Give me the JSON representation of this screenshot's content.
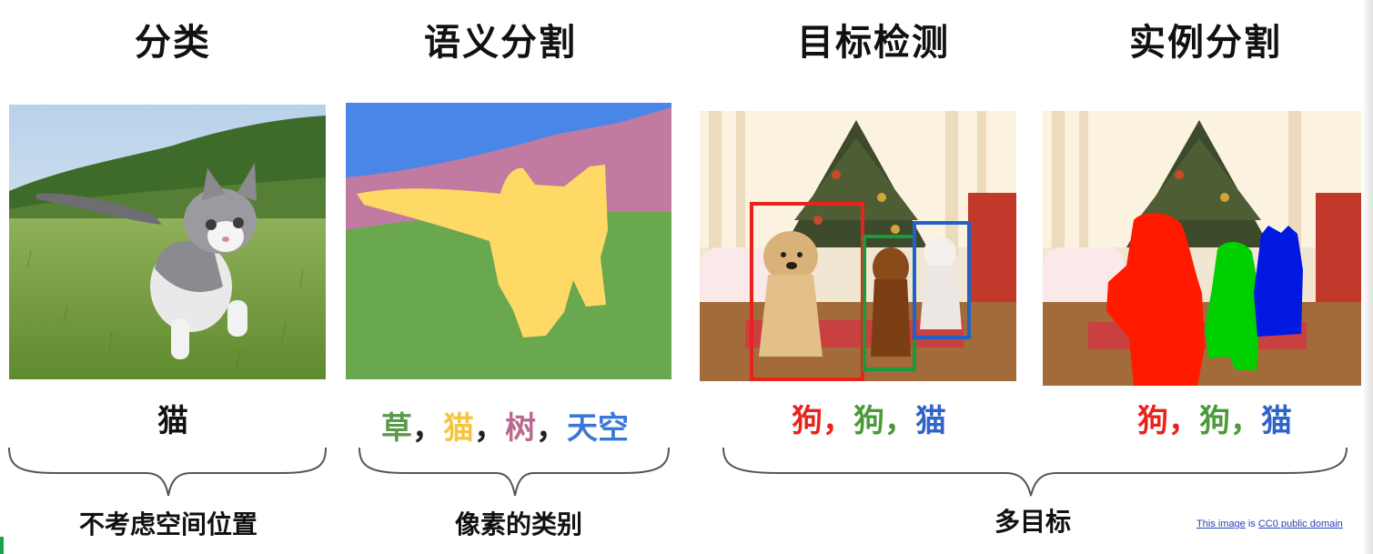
{
  "titles": {
    "classification": "分类",
    "semantic_segmentation": "语义分割",
    "object_detection": "目标检测",
    "instance_segmentation": "实例分割"
  },
  "labels": {
    "classification": "猫",
    "semantic": [
      {
        "text": "草",
        "color": "#5a9a4a"
      },
      {
        "text": "，",
        "color": "#222222"
      },
      {
        "text": "猫",
        "color": "#f5c542"
      },
      {
        "text": "，",
        "color": "#222222"
      },
      {
        "text": "树",
        "color": "#b86b8e"
      },
      {
        "text": "，",
        "color": "#222222"
      },
      {
        "text": "天空",
        "color": "#3a78d8"
      }
    ],
    "detection": [
      {
        "text": "狗",
        "color": "#e8231c"
      },
      {
        "text": "，",
        "color": "#e8231c"
      },
      {
        "text": "狗",
        "color": "#4a9a3a"
      },
      {
        "text": "，",
        "color": "#4a9a3a"
      },
      {
        "text": "猫",
        "color": "#2e63c8"
      }
    ],
    "instance": [
      {
        "text": "狗",
        "color": "#e8231c"
      },
      {
        "text": "，",
        "color": "#e8231c"
      },
      {
        "text": "狗",
        "color": "#4a9a3a"
      },
      {
        "text": "，",
        "color": "#4a9a3a"
      },
      {
        "text": "猫",
        "color": "#2e63c8"
      }
    ]
  },
  "bottom_labels": {
    "classification": "不考虑空间位置",
    "semantic": "像素的类别",
    "multi": "多目标"
  },
  "credit": {
    "prefix": "This image",
    "mid": " is ",
    "suffix": "CC0 public domain"
  },
  "colors": {
    "sky_mask": "#4a86e8",
    "tree_mask": "#c27ba0",
    "grass_mask": "#6aa84f",
    "cat_mask": "#ffd966",
    "det_red": "#e8231c",
    "det_green": "#1a9a3a",
    "det_blue": "#1f63c8",
    "inst_red": "#ff1a00",
    "inst_green": "#00d000",
    "inst_blue": "#0018e0"
  }
}
